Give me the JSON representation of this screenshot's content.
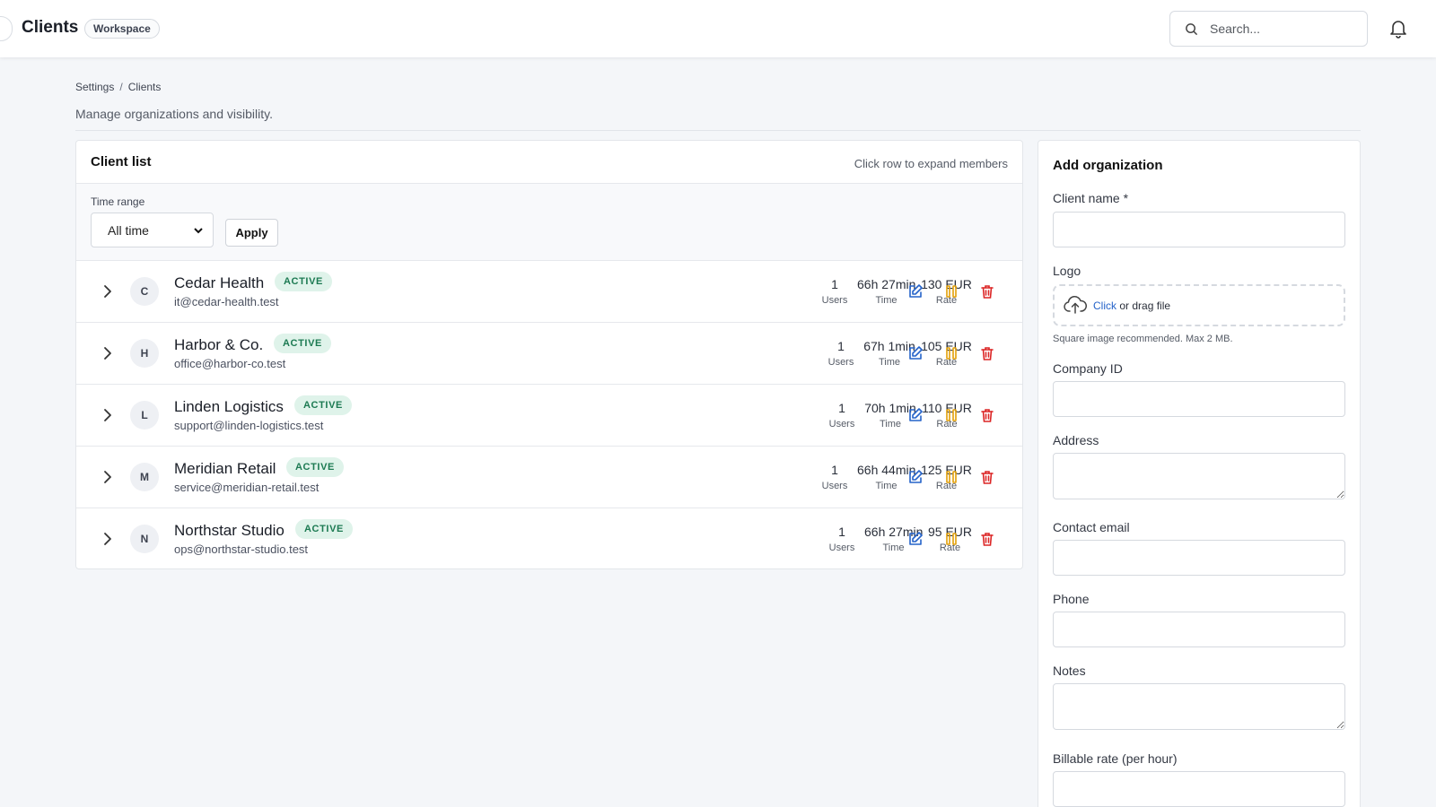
{
  "header": {
    "title": "Clients",
    "badge": "Workspace",
    "search_placeholder": "Search..."
  },
  "breadcrumb": {
    "parent": "Settings",
    "separator": "/",
    "current": "Clients"
  },
  "page_subtitle": "Manage organizations and visibility.",
  "client_list": {
    "title": "Client list",
    "hint": "Click row to expand members",
    "filter": {
      "label": "Time range",
      "selected": "All time",
      "apply_label": "Apply"
    },
    "stat_labels": {
      "users": "Users",
      "time": "Time",
      "rate": "Rate"
    },
    "rows": [
      {
        "initial": "C",
        "name": "Cedar Health",
        "status": "ACTIVE",
        "email": "it@cedar-health.test",
        "users": "1",
        "time": "66h 27min",
        "rate": "130 EUR"
      },
      {
        "initial": "H",
        "name": "Harbor & Co.",
        "status": "ACTIVE",
        "email": "office@harbor-co.test",
        "users": "1",
        "time": "67h 1min",
        "rate": "105 EUR"
      },
      {
        "initial": "L",
        "name": "Linden Logistics",
        "status": "ACTIVE",
        "email": "support@linden-logistics.test",
        "users": "1",
        "time": "70h 1min",
        "rate": "110 EUR"
      },
      {
        "initial": "M",
        "name": "Meridian Retail",
        "status": "ACTIVE",
        "email": "service@meridian-retail.test",
        "users": "1",
        "time": "66h 44min",
        "rate": "125 EUR"
      },
      {
        "initial": "N",
        "name": "Northstar Studio",
        "status": "ACTIVE",
        "email": "ops@northstar-studio.test",
        "users": "1",
        "time": "66h 27min",
        "rate": "95 EUR"
      }
    ]
  },
  "add_organization": {
    "title": "Add organization",
    "client_name_label": "Client name *",
    "logo_label": "Logo",
    "logo_click": "Click",
    "logo_drag": "or drag file",
    "logo_help": "Square image recommended. Max 2 MB.",
    "company_id_label": "Company ID",
    "address_label": "Address",
    "contact_email_label": "Contact email",
    "phone_label": "Phone",
    "notes_label": "Notes",
    "rate_label": "Billable rate (per hour)"
  },
  "colors": {
    "accent_blue": "#2563c9",
    "pause_amber": "#e3a008",
    "delete_red": "#dc2626",
    "status_bg": "#dff3ea",
    "status_text": "#1c7a52"
  },
  "icons": [
    "search-icon",
    "bell-icon",
    "chevron-right-icon",
    "edit-icon",
    "pause-icon",
    "trash-icon",
    "cloud-upload-icon",
    "chevron-down-icon"
  ]
}
